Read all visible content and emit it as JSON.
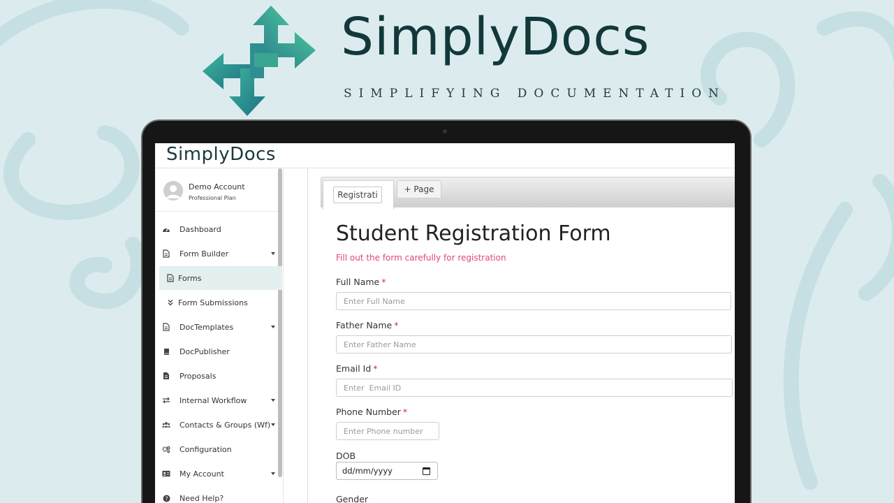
{
  "brand": {
    "name": "SimplyDocs",
    "tagline": "SIMPLIFYING DOCUMENTATION"
  },
  "app": {
    "logo": "SimplyDocs"
  },
  "account": {
    "name": "Demo Account",
    "plan": "Professional Plan"
  },
  "sidebar": {
    "items": [
      {
        "label": "Dashboard",
        "icon": "dashboard-icon"
      },
      {
        "label": "Form Builder",
        "icon": "file-icon",
        "caret": true
      },
      {
        "label": "Forms",
        "icon": "file-icon",
        "active": true
      },
      {
        "label": "Form Submissions",
        "icon": "double-chevron-down-icon"
      },
      {
        "label": "DocTemplates",
        "icon": "file-icon",
        "caret": true
      },
      {
        "label": "DocPublisher",
        "icon": "book-icon"
      },
      {
        "label": "Proposals",
        "icon": "document-icon"
      },
      {
        "label": "Internal Workflow",
        "icon": "exchange-icon",
        "caret": true
      },
      {
        "label": "Contacts & Groups (Wf)",
        "icon": "users-icon",
        "caret": true
      },
      {
        "label": "Configuration",
        "icon": "cogs-icon"
      },
      {
        "label": "My Account",
        "icon": "id-card-icon",
        "caret": true
      },
      {
        "label": "Need Help?",
        "icon": "question-icon"
      }
    ]
  },
  "tabs": {
    "active": "Registrati",
    "add_label": "+ Page"
  },
  "form": {
    "title": "Student Registration Form",
    "subtitle": "Fill out the form carefully for registration",
    "required_mark": "*",
    "fields": [
      {
        "label": "Full Name",
        "placeholder": "Enter Full Name"
      },
      {
        "label": "Father Name",
        "placeholder": "Enter Father Name"
      },
      {
        "label": "Email Id",
        "placeholder": "Enter  Email ID"
      },
      {
        "label": "Phone Number",
        "placeholder": "Enter Phone number"
      }
    ],
    "dob_label": "DOB",
    "dob_value": "dd/mm/yyyy",
    "gender_label": "Gender"
  },
  "colors": {
    "background": "#dcecee",
    "brand_dark": "#12383a",
    "accent_pink": "#e0457b",
    "required_red": "#d32f2f",
    "logo_teal": "#2e9e8f"
  }
}
